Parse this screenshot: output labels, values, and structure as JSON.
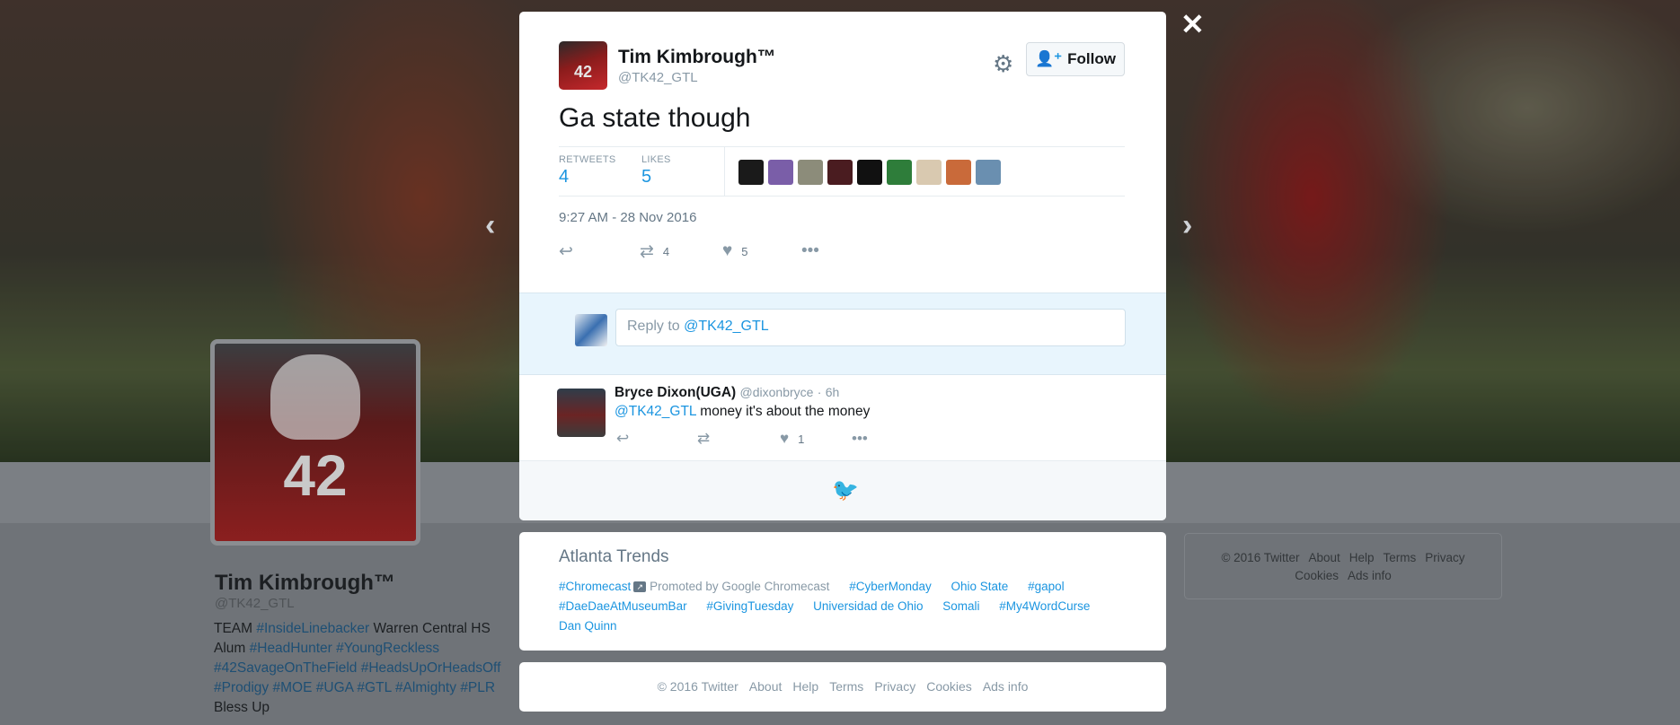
{
  "background": {
    "profile": {
      "name": "Tim Kimbrough™",
      "handle": "@TK42_GTL",
      "photo_number": "42",
      "bio": [
        {
          "text": "TEAM ",
          "tag": false
        },
        {
          "text": "#InsideLinebacker",
          "tag": true
        },
        {
          "text": " Warren Central HS Alum ",
          "tag": false
        },
        {
          "text": "#HeadHunter",
          "tag": true
        },
        {
          "text": " ",
          "tag": false
        },
        {
          "text": "#YoungReckless",
          "tag": true
        },
        {
          "text": " ",
          "tag": false
        },
        {
          "text": "#42SavageOnTheField",
          "tag": true
        },
        {
          "text": " ",
          "tag": false
        },
        {
          "text": "#HeadsUpOrHeadsOff",
          "tag": true
        },
        {
          "text": " ",
          "tag": false
        },
        {
          "text": "#Prodigy",
          "tag": true
        },
        {
          "text": " ",
          "tag": false
        },
        {
          "text": "#MOE",
          "tag": true
        },
        {
          "text": " ",
          "tag": false
        },
        {
          "text": "#UGA",
          "tag": true
        },
        {
          "text": " ",
          "tag": false
        },
        {
          "text": "#GTL",
          "tag": true
        },
        {
          "text": " ",
          "tag": false
        },
        {
          "text": "#Almighty",
          "tag": true
        },
        {
          "text": " ",
          "tag": false
        },
        {
          "text": "#PLR",
          "tag": true
        },
        {
          "text": " Bless Up",
          "tag": false
        }
      ]
    },
    "footer_links": [
      "© 2016 Twitter",
      "About",
      "Help",
      "Terms",
      "Privacy",
      "Cookies",
      "Ads info"
    ]
  },
  "modal": {
    "close_icon": "close-icon",
    "author": {
      "name": "Tim Kimbrough™",
      "handle": "@TK42_GTL",
      "avatar_number": "42"
    },
    "follow_label": "Follow",
    "tweet_text": "Ga state though",
    "stats": {
      "retweets_label": "RETWEETS",
      "retweets": "4",
      "likes_label": "LIKES",
      "likes": "5",
      "liker_colors": [
        "#1a1a1a",
        "#7a5ea8",
        "#8c8c7a",
        "#4a1c20",
        "#111111",
        "#2e7d3a",
        "#d9c9b0",
        "#c96a3a",
        "#6a8fb0"
      ]
    },
    "timestamp": "9:27 AM - 28 Nov 2016",
    "actions": {
      "retweet_count": "4",
      "like_count": "5"
    },
    "reply_box": {
      "prefix": "Reply to ",
      "mention": "@TK42_GTL"
    },
    "reply": {
      "name": "Bryce Dixon(UGA)",
      "handle": "@dixonbryce",
      "time": "6h",
      "mention": "@TK42_GTL",
      "text": " money it's about the money",
      "like_count": "1"
    }
  },
  "trends": {
    "title": "Atlanta Trends",
    "promoted_text": "Promoted by Google Chromecast",
    "items": [
      "#Chromecast",
      "#CyberMonday",
      "Ohio State",
      "#gapol",
      "#DaeDaeAtMuseumBar",
      "#GivingTuesday",
      "Universidad de Ohio",
      "Somali",
      "#My4WordCurse",
      "Dan Quinn"
    ]
  },
  "footer": {
    "links": [
      "© 2016 Twitter",
      "About",
      "Help",
      "Terms",
      "Privacy",
      "Cookies",
      "Ads info"
    ]
  },
  "colors": {
    "accent": "#1b95e0",
    "text": "#14171a",
    "muted": "#8899a6"
  }
}
